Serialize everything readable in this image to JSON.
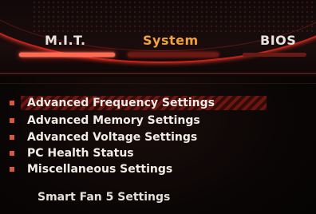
{
  "tabs": [
    {
      "label": "M.I.T.",
      "active": true
    },
    {
      "label": "System",
      "active": false
    },
    {
      "label": "BIOS",
      "active": false
    }
  ],
  "menu": {
    "items": [
      {
        "label": "Advanced Frequency Settings",
        "selected": true
      },
      {
        "label": "Advanced Memory Settings",
        "selected": false
      },
      {
        "label": "Advanced Voltage Settings",
        "selected": false
      },
      {
        "label": "PC Health Status",
        "selected": false
      },
      {
        "label": "Miscellaneous Settings",
        "selected": false
      }
    ],
    "extra_item": "Smart Fan 5 Settings"
  },
  "colors": {
    "accent": "#e0281c",
    "tab_active_text": "#e8e2dc",
    "tab_secondary_text": "#f2a23a",
    "bullet": "#d9593c",
    "background": "#0b0606"
  }
}
